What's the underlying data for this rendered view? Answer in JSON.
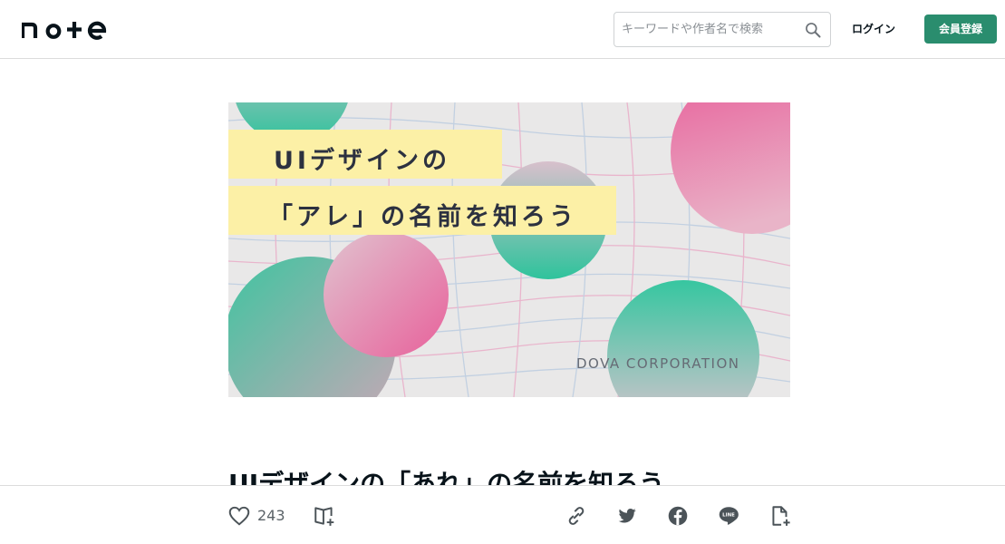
{
  "header": {
    "logo_text": "note",
    "search_placeholder": "キーワードや作者名で検索",
    "login_label": "ログイン",
    "register_label": "会員登録",
    "register_color": "#2a8d6e"
  },
  "eyecatch": {
    "line1": "UIデザインの",
    "line2": "「アレ」の名前を知ろう",
    "brand": "DOVA CORPORATION",
    "colors": {
      "pink": "#e86ba0",
      "green": "#3fc4a0",
      "highlight": "#fcf0a6",
      "background": "#e9e8e8"
    }
  },
  "article": {
    "title": "UIデザインの「あれ」の名前を知ろう"
  },
  "actions": {
    "like_count": "243",
    "icons": [
      "heart-icon",
      "magazine-add-icon",
      "link-icon",
      "twitter-icon",
      "facebook-icon",
      "line-icon",
      "embed-icon"
    ]
  }
}
